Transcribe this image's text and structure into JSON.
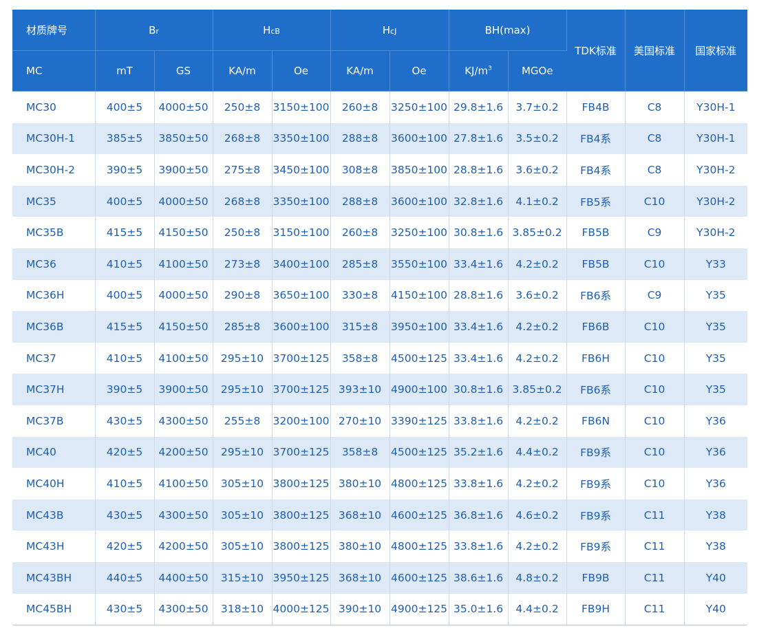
{
  "header": {
    "grade": "材质牌号",
    "br": {
      "main": "B",
      "sub": "r"
    },
    "hcb": {
      "main": "H",
      "sub": "cB"
    },
    "hcj": {
      "main": "H",
      "sub": "cJ"
    },
    "bhmax": "BH(max)",
    "tdk": "TDK标准",
    "us": "美国标准",
    "national": "国家标准",
    "units": {
      "grade": "MC",
      "br_mt": "mT",
      "br_gs": "GS",
      "hcb_kam": "KA/m",
      "hcb_oe": "Oe",
      "hcj_kam": "KA/m",
      "hcj_oe": "Oe",
      "bh_kj": "KJ/m",
      "bh_kj_sup": "3",
      "bh_mgoe": "MGOe"
    }
  },
  "rows": [
    [
      "MC30",
      "400±5",
      "4000±50",
      "250±8",
      "3150±100",
      "260±8",
      "3250±100",
      "29.8±1.6",
      "3.7±0.2",
      "FB4B",
      "C8",
      "Y30H-1"
    ],
    [
      "MC30H-1",
      "385±5",
      "3850±50",
      "268±8",
      "3350±100",
      "288±8",
      "3600±100",
      "27.8±1.6",
      "3.5±0.2",
      "FB4系",
      "C8",
      "Y30H-1"
    ],
    [
      "MC30H-2",
      "390±5",
      "3900±50",
      "275±8",
      "3450±100",
      "308±8",
      "3850±100",
      "28.8±1.6",
      "3.6±0.2",
      "FB4系",
      "C8",
      "Y30H-2"
    ],
    [
      "MC35",
      "400±5",
      "4000±50",
      "268±8",
      "3350±100",
      "288±8",
      "3600±100",
      "32.8±1.6",
      "4.1±0.2",
      "FB5系",
      "C10",
      "Y30H-2"
    ],
    [
      "MC35B",
      "415±5",
      "4150±50",
      "250±8",
      "3150±100",
      "260±8",
      "3250±100",
      "30.8±1.6",
      "3.85±0.2",
      "FB5B",
      "C9",
      "Y30H-2"
    ],
    [
      "MC36",
      "410±5",
      "4100±50",
      "273±8",
      "3400±100",
      "285±8",
      "3550±100",
      "33.4±1.6",
      "4.2±0.2",
      "FB5B",
      "C10",
      "Y33"
    ],
    [
      "MC36H",
      "400±5",
      "4000±50",
      "290±8",
      "3650±100",
      "330±8",
      "4150±100",
      "28.8±1.6",
      "3.6±0.2",
      "FB6系",
      "C9",
      "Y35"
    ],
    [
      "MC36B",
      "415±5",
      "4150±50",
      "285±8",
      "3600±100",
      "315±8",
      "3950±100",
      "33.4±1.6",
      "4.2±0.2",
      "FB6B",
      "C10",
      "Y35"
    ],
    [
      "MC37",
      "410±5",
      "4100±50",
      "295±10",
      "3700±125",
      "358±8",
      "4500±125",
      "33.4±1.6",
      "4.2±0.2",
      "FB6H",
      "C10",
      "Y35"
    ],
    [
      "MC37H",
      "390±5",
      "3900±50",
      "295±10",
      "3700±125",
      "393±10",
      "4900±100",
      "30.8±1.6",
      "3.85±0.2",
      "FB6系",
      "C10",
      "Y35"
    ],
    [
      "MC37B",
      "430±5",
      "4300±50",
      "255±8",
      "3200±100",
      "270±10",
      "3390±125",
      "33.8±1.6",
      "4.2±0.2",
      "FB6N",
      "C10",
      "Y36"
    ],
    [
      "MC40",
      "420±5",
      "4200±50",
      "295±10",
      "3700±125",
      "358±8",
      "4500±125",
      "35.2±1.6",
      "4.4±0.2",
      "FB9系",
      "C10",
      "Y36"
    ],
    [
      "MC40H",
      "410±5",
      "4100±50",
      "305±10",
      "3800±125",
      "380±10",
      "4800±125",
      "33.8±1.6",
      "4.2±0.2",
      "FB9系",
      "C10",
      "Y36"
    ],
    [
      "MC43B",
      "430±5",
      "4300±50",
      "305±10",
      "3800±125",
      "368±10",
      "4600±125",
      "36.8±1.6",
      "4.6±0.2",
      "FB9系",
      "C11",
      "Y38"
    ],
    [
      "MC43H",
      "420±5",
      "4200±50",
      "305±10",
      "3800±125",
      "380±10",
      "4800±125",
      "33.8±1.6",
      "4.2±0.2",
      "FB9系",
      "C11",
      "Y38"
    ],
    [
      "MC43BH",
      "440±5",
      "4400±50",
      "315±10",
      "3950±125",
      "368±10",
      "4600±125",
      "38.6±1.6",
      "4.8±0.2",
      "FB9B",
      "C11",
      "Y40"
    ],
    [
      "MC45BH",
      "430±5",
      "4300±50",
      "318±10",
      "4000±125",
      "390±10",
      "4900±125",
      "35.0±1.6",
      "4.4±0.2",
      "FB9H",
      "C11",
      "Y40"
    ]
  ]
}
